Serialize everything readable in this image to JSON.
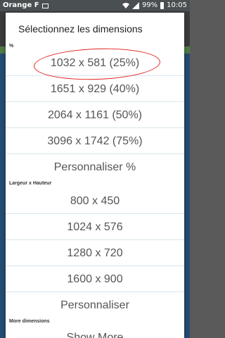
{
  "status_bar": {
    "carrier": "Orange F",
    "battery": "99%",
    "time": "10:05"
  },
  "dialog": {
    "title": "Sélectionnez les dimensions",
    "percent_section_label": "%",
    "percent_options": [
      {
        "label": "1032 x 581  (25%)"
      },
      {
        "label": "1651 x 929  (40%)"
      },
      {
        "label": "2064 x 1161  (50%)"
      },
      {
        "label": "3096 x 1742  (75%)"
      }
    ],
    "custom_percent_label": "Personnaliser %",
    "size_section_label": "Largeur x Hauteur",
    "size_options": [
      {
        "label": "800 x 450"
      },
      {
        "label": "1024 x 576"
      },
      {
        "label": "1280 x 720"
      },
      {
        "label": "1600 x 900"
      }
    ],
    "custom_size_label": "Personnaliser",
    "more_section_label": "More dimensions",
    "show_more_label": "Show More"
  },
  "colors": {
    "highlight_ellipse": "#e0221e",
    "divider": "#d8e6ec",
    "status_bar": "#4a4f52"
  }
}
